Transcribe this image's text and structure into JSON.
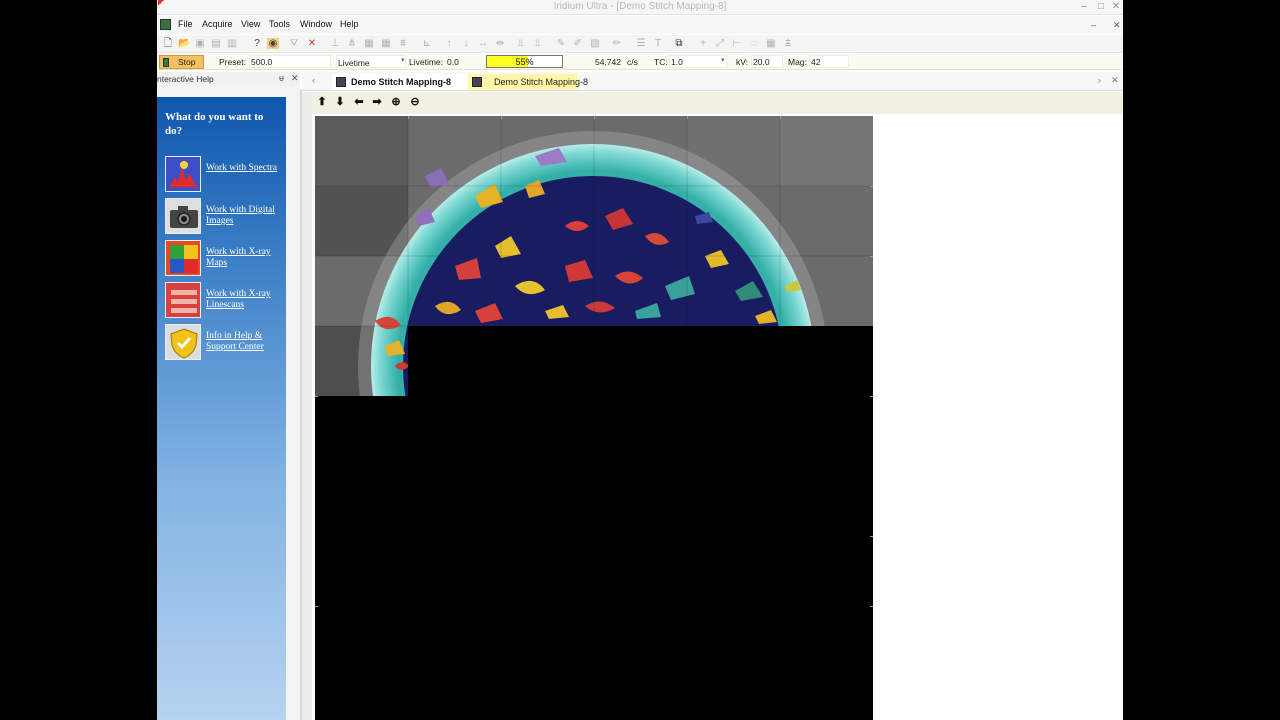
{
  "window": {
    "title": "Iridium Ultra - [Demo Stitch Mapping-8]",
    "controls": [
      "–",
      "□",
      "✕"
    ]
  },
  "menu": {
    "items": [
      "File",
      "Acquire",
      "View",
      "Tools",
      "Window",
      "Help"
    ],
    "mdi_controls": [
      "–",
      "✕"
    ]
  },
  "toolbar": {
    "icons": [
      "new-file-icon",
      "open-folder-icon",
      "save-icon",
      "save-all-icon",
      "print-icon",
      "help-pointer-icon",
      "eye-icon",
      "filter-icon",
      "delete-spectrum-icon",
      "peak-icon",
      "peak-grid-icon",
      "stack-icon",
      "stack2-icon",
      "comb-icon",
      "axis-icon",
      "arrow-up-icon",
      "arrow-down-icon",
      "expand-h-icon",
      "shrink-h-icon",
      "bars-icon",
      "bars2-icon",
      "pen-icon",
      "edit-chart-icon",
      "chart-icon",
      "pencil-icon",
      "table-icon",
      "text-icon",
      "copy-image-icon",
      "crosshair-icon",
      "diagonal-icon",
      "line-icon",
      "circle-icon",
      "grid-icon",
      "sum-icon"
    ]
  },
  "acquisition": {
    "stop_label": "Stop",
    "preset_label": "Preset:",
    "preset_value": "500.0",
    "mode_value": "Livetime",
    "livetime_label": "Livetime:",
    "livetime_value": "0.0",
    "progress_percent": 55,
    "progress_text": "55%",
    "rate_value": "54,742",
    "rate_unit": "c/s",
    "tc_label": "TC:",
    "tc_value": "1.0",
    "kv_label": "kV:",
    "kv_value": "20.0",
    "mag_label": "Mag:",
    "mag_value": "42"
  },
  "help_pane": {
    "title": "nteractive Help",
    "pin": "ᵾ",
    "close": "✕",
    "question": "What do you want to do?",
    "items": [
      {
        "label": "Work with Spectra",
        "icon": "spectra-icon"
      },
      {
        "label": "Work with Digital Images",
        "icon": "camera-icon"
      },
      {
        "label": "Work with X-ray Maps",
        "icon": "xray-maps-icon"
      },
      {
        "label": "Work with X-ray Linescans",
        "icon": "linescan-icon"
      },
      {
        "label": "Info in Help & Support Center",
        "icon": "shield-icon"
      }
    ]
  },
  "tabs": [
    {
      "label": "Demo Stitch Mapping-8",
      "active": true
    },
    {
      "label": "Demo Stitch Mapping-8",
      "active": false
    }
  ],
  "doc_toolbar": {
    "buttons": [
      "arrow-up-icon",
      "arrow-down-icon",
      "arrow-left-icon",
      "arrow-right-icon",
      "zoom-in-icon",
      "zoom-out-icon"
    ]
  }
}
